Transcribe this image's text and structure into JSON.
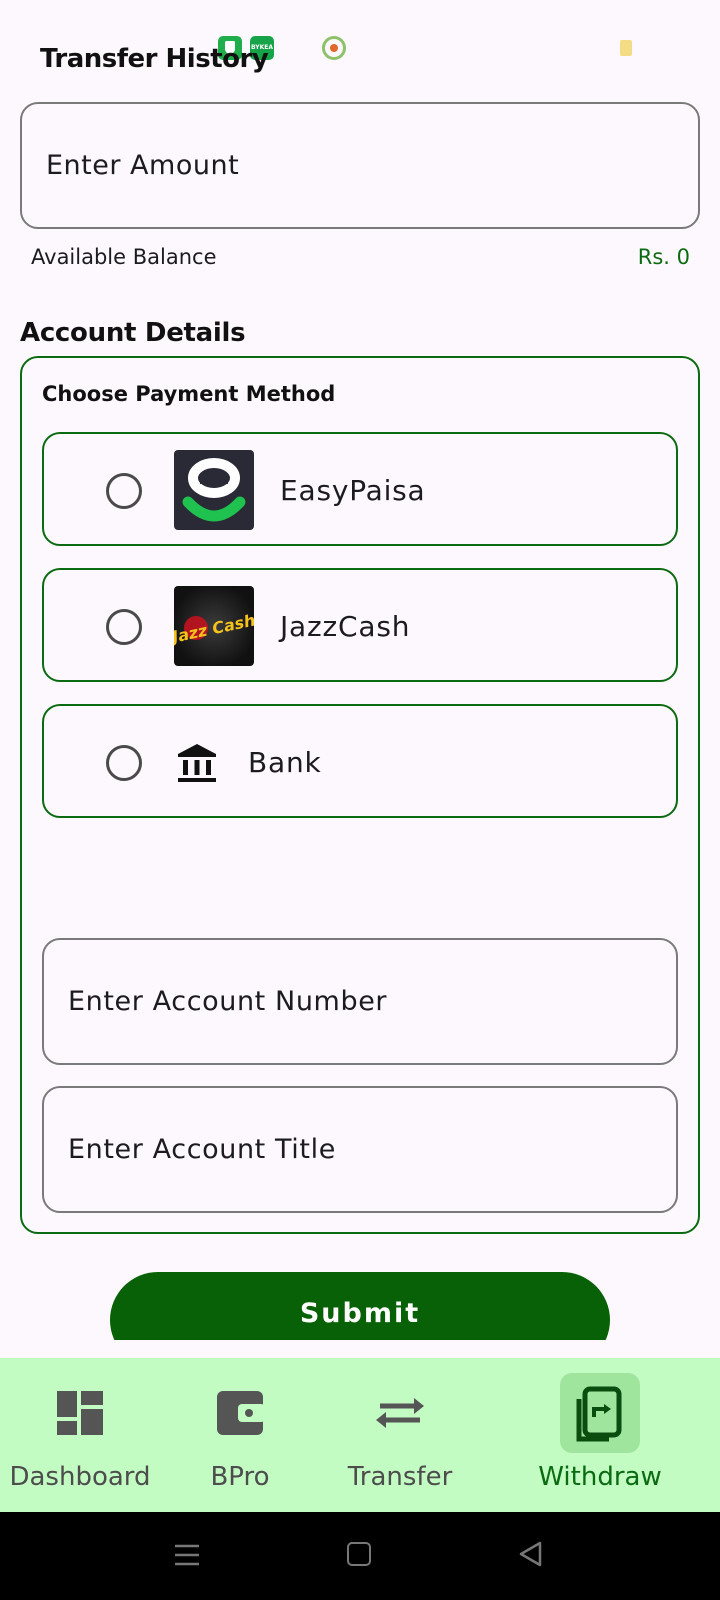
{
  "header": {
    "title": "Transfer History"
  },
  "status_bar": {
    "icons": [
      "shield-icon",
      "bykea-icon",
      "ring-icon",
      "battery-icon"
    ],
    "bykea_text": "BYKEA"
  },
  "amount": {
    "placeholder": "Enter Amount"
  },
  "balance": {
    "label": "Available Balance",
    "value": "Rs. 0"
  },
  "account": {
    "section_title": "Account Details",
    "choose_label": "Choose Payment Method",
    "methods": [
      {
        "label": "EasyPaisa",
        "icon": "easypaisa-logo"
      },
      {
        "label": "JazzCash",
        "icon": "jazzcash-logo",
        "logo_text": "Jazz Cash"
      },
      {
        "label": "Bank",
        "icon": "bank-icon"
      }
    ],
    "account_number_placeholder": "Enter Account Number",
    "account_title_placeholder": "Enter Account Title"
  },
  "submit": {
    "label": "Submit"
  },
  "bottom_nav": {
    "items": [
      {
        "label": "Dashboard",
        "icon": "dashboard-icon"
      },
      {
        "label": "BPro",
        "icon": "wallet-icon"
      },
      {
        "label": "Transfer",
        "icon": "transfer-arrows-icon"
      },
      {
        "label": "Withdraw",
        "icon": "withdraw-icon",
        "active": true
      }
    ]
  },
  "colors": {
    "accent": "#0b6b12",
    "button": "#086106",
    "nav_bg": "#c2fcc2",
    "nav_active": "#9fe59e"
  }
}
